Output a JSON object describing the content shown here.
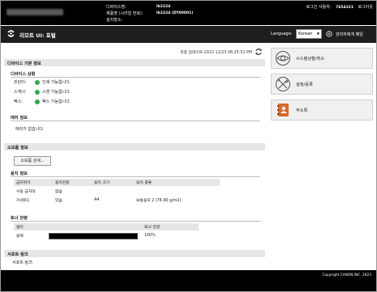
{
  "header": {
    "device_labels": [
      "디바이스명:",
      "제품명 (시리얼 번호):",
      "설치장소:"
    ],
    "device_values": [
      "lb2224",
      "lb2224 (DY00001)",
      ""
    ],
    "login_label": "로그인 사용자:",
    "login_user": "7654321",
    "logout": "로그아웃"
  },
  "titlebar": {
    "title": "리모트 UI: 포털",
    "language_label": "Language:",
    "language_value": "Korean",
    "admin_mail": "관리자에게 메일"
  },
  "main": {
    "updated": "최종 업데이트:2022 12/23 06:25:52 PM",
    "device_basic_info": {
      "heading": "디바이스 기본 정보",
      "status_heading": "디바이스 상황",
      "rows": [
        {
          "label": "프린터:",
          "status": "인쇄 가능합니다."
        },
        {
          "label": "스캐너:",
          "status": "스캔 가능합니다."
        },
        {
          "label": "팩스:",
          "status": "팩스 가능합니다."
        }
      ],
      "error_heading": "에러 정보",
      "error_text": "에러가 없습니다."
    },
    "consumables": {
      "heading": "소모품 정보",
      "detail_button": "소모품 상세...",
      "paper_heading": "용지 정보",
      "paper_columns": [
        "급지위치",
        "용지잔량",
        "용지 크기",
        "용지 종류"
      ],
      "paper_rows": [
        [
          "수동 급지대",
          "없음",
          "",
          ""
        ],
        [
          "카세트1",
          "있음",
          "A4",
          "보통용지 2 (76-90 g/m2)"
        ]
      ],
      "toner_heading": "토너 잔량",
      "toner_columns": [
        "컬러",
        "토너 잔량"
      ],
      "toner_rows": [
        {
          "color": "블랙",
          "level": "100%"
        }
      ]
    },
    "support": {
      "heading": "서포트 링크",
      "link_label": "서포트 링크:"
    }
  },
  "side": {
    "buttons": [
      {
        "label": "시스템상황/취소",
        "icon": "status-monitor-icon"
      },
      {
        "label": "설정/등록",
        "icon": "settings-icon"
      },
      {
        "label": "주소록",
        "icon": "address-book-icon"
      }
    ]
  },
  "footer": {
    "copyright": "Copyright CANON INC. 2023"
  },
  "colors": {
    "header_bg": "#000000",
    "titlebar_bg": "#1e1e1e",
    "status_ok": "#2fa84f",
    "address_book": "#d86a2c"
  }
}
